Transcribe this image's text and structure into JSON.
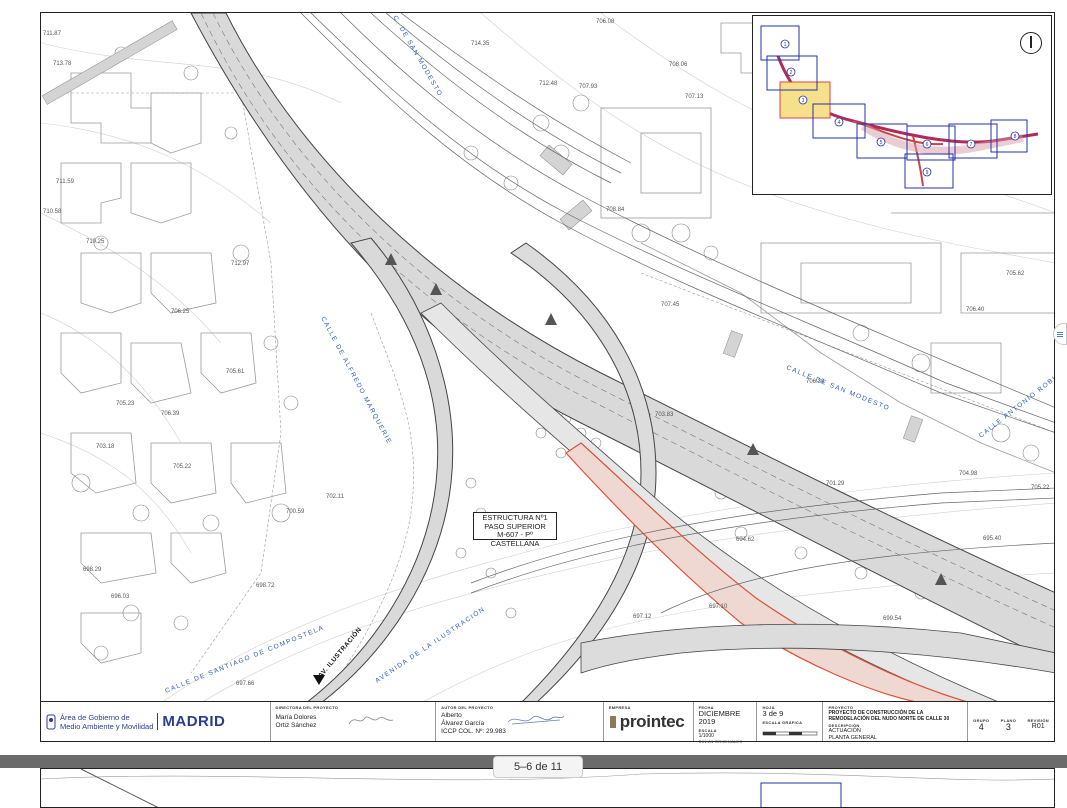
{
  "viewer": {
    "page_indicator": "5–6 de 11"
  },
  "map": {
    "callout": {
      "line1": "ESTRUCTURA Nº1",
      "line2": "PASO SUPERIOR",
      "line3": "M-607 - Pº CASTELLANA"
    },
    "streets": {
      "san_modesto_top": "C. DE SAN MODESTO",
      "san_modesto": "CALLE DE SAN MODESTO",
      "alfredo_marquerie": "CALLE DE ALFREDO MARQUERIE",
      "antonio_robles": "CALLE ANTONIO ROBLES",
      "santiago_compostela": "CALLE DE SANTIAGO DE COMPOSTELA",
      "ilustracion": "AVENIDA DE LA ILUSTRACIÓN",
      "av_ilustracion": "AV. ILUSTRACIÓN"
    },
    "elevations": {
      "e1": "711.87",
      "e2": "713.78",
      "e3": "711.59",
      "e4": "710.58",
      "e5": "710.25",
      "e6": "712.97",
      "e7": "706.25",
      "e8": "705.61",
      "e9": "705.23",
      "e10": "706.39",
      "e11": "703.18",
      "e12": "705.22",
      "e13": "702.11",
      "e14": "700.59",
      "e15": "698.29",
      "e16": "698.72",
      "e17": "697.66",
      "e18": "696.03",
      "e19": "707.93",
      "e20": "707.13",
      "e21": "706.08",
      "e22": "708.84",
      "e23": "707.45",
      "e24": "705.62",
      "e25": "706.40",
      "e26": "703.83",
      "e27": "701.29",
      "e28": "697.12",
      "e29": "697.10",
      "e30": "695.40",
      "e31": "699.54",
      "e32": "694.62",
      "e33": "704.98",
      "e34": "705.22",
      "e35": "706.38",
      "e36": "708.06",
      "e37": "714.35",
      "e38": "712.48"
    }
  },
  "titleblock": {
    "org_line1": "Área de Gobierno de",
    "org_line2": "Medio Ambiente y Movilidad",
    "city": "MADRID",
    "director_caption": "DIRECTORA DEL PROYECTO",
    "director_line1": "María Dolores",
    "director_line2": "Ortiz Sánchez",
    "author_caption": "AUTOR DEL PROYECTO",
    "author_line1": "Alberto",
    "author_line2": "Álvarez García",
    "author_line3": "ICCP COL. Nº: 29.983",
    "company_caption": "EMPRESA",
    "company": "prointec",
    "date_caption": "FECHA",
    "date": "DICIEMBRE 2019",
    "sheet_caption": "HOJA",
    "sheet": "3 de 9",
    "scale_caption": "ESCALA",
    "scale": "1/1000",
    "scale_note": "DIN-A1 ORIGINALES",
    "graphic_scale_caption": "ESCALA GRÁFICA",
    "project_caption": "PROYECTO",
    "project": "PROYECTO DE CONSTRUCCIÓN DE LA REMODELACIÓN DEL NUDO NORTE DE CALLE 30",
    "description_caption": "DESCRIPCIÓN",
    "description_line1": "ACTUACIÓN",
    "description_line2": "PLANTA GENERAL",
    "group_caption": "GRUPO",
    "group": "4",
    "plan_caption": "PLANO",
    "plan": "3",
    "revision_caption": "REVISIÓN",
    "revision": "R01"
  },
  "inset": {
    "numbers": [
      "1",
      "2",
      "3",
      "4",
      "5",
      "6",
      "7",
      "8",
      "9"
    ]
  }
}
